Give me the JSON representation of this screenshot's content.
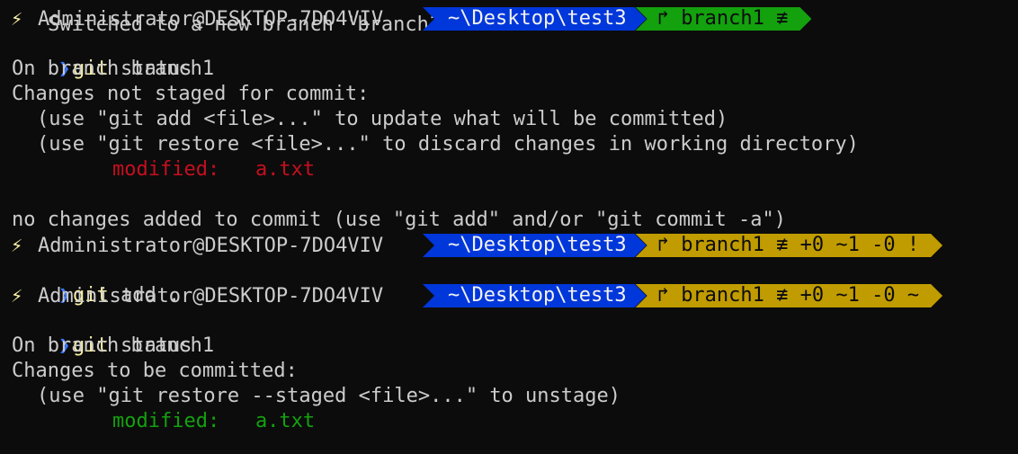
{
  "top_partial": "Switched to a new branch 'branch1'",
  "prompt": {
    "bolt": "⚡",
    "user": "Administrator@DESKTOP-7DO4VIV",
    "path": "~\\Desktop\\test3",
    "branch_icon": "branch-icon",
    "colors": {
      "path_bg": "#0037da",
      "git_clean_bg": "#13a10e",
      "git_dirty_bg": "#c19c00",
      "chevron": "#3b78ff",
      "bolt": "#f9f1a5"
    }
  },
  "blocks": [
    {
      "git_status": "branch1 ≢",
      "command_git": "git",
      "command_rest": " status",
      "output": [
        {
          "text": "On branch branch1",
          "style": "plain"
        },
        {
          "text": "Changes not staged for commit:",
          "style": "plain"
        },
        {
          "text": "(use \"git add <file>...\" to update what will be committed)",
          "style": "hint"
        },
        {
          "text": "(use \"git restore <file>...\" to discard changes in working directory)",
          "style": "hint"
        },
        {
          "text": "modified:   a.txt",
          "style": "modified-red"
        },
        {
          "text": "",
          "style": "plain"
        },
        {
          "text": "no changes added to commit (use \"git add\" and/or \"git commit -a\")",
          "style": "plain"
        }
      ]
    },
    {
      "git_status": "branch1 ≢ +0 ~1 -0 !",
      "command_git": "git",
      "command_rest": " add .",
      "output": []
    },
    {
      "git_status": "branch1 ≢ +0 ~1 -0 ~",
      "command_git": "git",
      "command_rest": " status",
      "output": [
        {
          "text": "On branch branch1",
          "style": "plain"
        },
        {
          "text": "Changes to be committed:",
          "style": "plain"
        },
        {
          "text": "(use \"git restore --staged <file>...\" to unstage)",
          "style": "hint"
        },
        {
          "text": "modified:   a.txt",
          "style": "modified-green"
        }
      ]
    }
  ]
}
